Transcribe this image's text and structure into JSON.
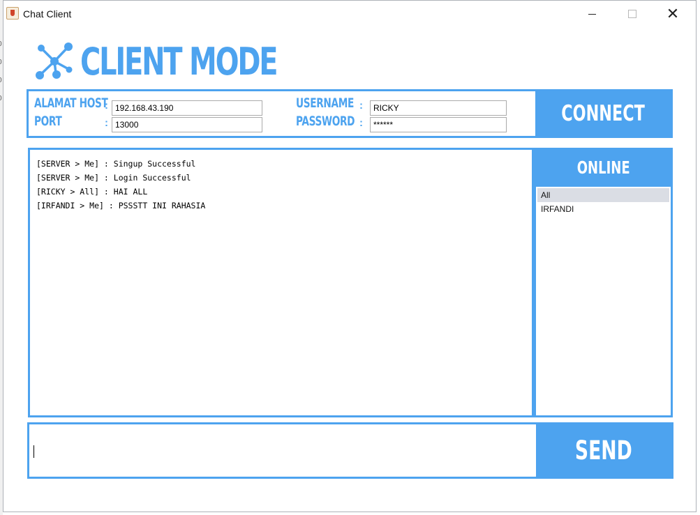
{
  "window": {
    "title": "Chat Client",
    "icon": "java-cup-icon",
    "controls": {
      "minimize": "minimize-icon",
      "maximize": "maximize-icon",
      "close": "✕"
    }
  },
  "header": {
    "title": "CLIENT MODE",
    "logo_icon": "network-nodes-icon"
  },
  "connection": {
    "host_label": "ALAMAT HOST",
    "port_label": "PORT",
    "username_label": "USERNAME",
    "password_label": "PASSWORD",
    "separator": ":",
    "host_value": "192.168.43.190",
    "port_value": "13000",
    "username_value": "RICKY",
    "password_value": "******",
    "connect_label": "CONNECT"
  },
  "chat": {
    "messages": [
      "[SERVER > Me] : Singup Successful",
      "[SERVER > Me] : Login Successful",
      "[RICKY > All] : HAI ALL",
      "[IRFANDI > Me] : PSSSTT INI RAHASIA"
    ]
  },
  "online": {
    "title": "ONLINE",
    "users": [
      "All",
      "IRFANDI"
    ],
    "selected": "All"
  },
  "compose": {
    "message_value": "",
    "send_label": "SEND"
  },
  "colors": {
    "accent": "#4da3ef",
    "selection": "#dadde4"
  }
}
